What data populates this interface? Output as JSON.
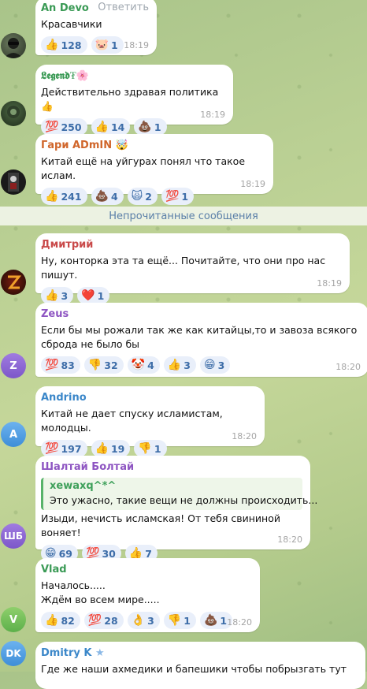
{
  "colors": {
    "link": "#3d6da8",
    "reaction_bg": "#e9effa",
    "timestamp": "#a5a5a5",
    "unread_text": "#5a7fa8"
  },
  "unread_divider": "Непрочитанные сообщения",
  "messages": [
    {
      "author": "An Devo",
      "author_color": "#3a9a55",
      "reply_label": "Ответить",
      "text": "Красавчики",
      "time": "18:19",
      "reactions": [
        {
          "emoji": "👍",
          "count": "128"
        },
        {
          "emoji": "🐷",
          "count": "1"
        }
      ]
    },
    {
      "author": "𝕷𝖊𝖌𝖊𝖓𝖉",
      "author_badge": "₮🌸",
      "author_color": "#3a9a55",
      "text": "Действительно здравая политика 👍",
      "time": "18:19",
      "reactions": [
        {
          "emoji": "💯",
          "count": "250"
        },
        {
          "emoji": "👍",
          "count": "14"
        },
        {
          "emoji": "💩",
          "count": "1"
        }
      ]
    },
    {
      "author": "Гари ADmIN",
      "author_badge": "🤯",
      "author_color": "#d0662b",
      "text": "Китай ещё на уйгурах понял что такое ислам.",
      "time": "18:19",
      "reactions": [
        {
          "emoji": "👍",
          "count": "241"
        },
        {
          "emoji": "💩",
          "count": "4"
        },
        {
          "emoji": "🙀",
          "count": "2"
        },
        {
          "emoji": "💯",
          "count": "1"
        }
      ]
    },
    {
      "author": "Дмитрий",
      "author_color": "#c94a4a",
      "text": "Ну, конторка эта та ещё... Почитайте, что они про нас пишут.",
      "time": "18:19",
      "reactions": [
        {
          "emoji": "👍",
          "count": "3"
        },
        {
          "emoji": "❤️",
          "count": "1"
        }
      ]
    },
    {
      "author": "Zeus",
      "author_color": "#8e55c2",
      "avatar_letter": "Z",
      "text": "Если бы мы рожали так же как китайцы,то и завоза всякого\nсброда не было бы",
      "time": "18:20",
      "reactions": [
        {
          "emoji": "💯",
          "count": "83"
        },
        {
          "emoji": "👎",
          "count": "32"
        },
        {
          "emoji": "🤡",
          "count": "4"
        },
        {
          "emoji": "👍",
          "count": "3"
        },
        {
          "emoji": "😁",
          "count": "3"
        }
      ]
    },
    {
      "author": "Andrino",
      "author_color": "#3b87c9",
      "avatar_letter": "A",
      "text": "Китай не дает спуску исламистам, молодцы.",
      "time": "18:20",
      "reactions": [
        {
          "emoji": "💯",
          "count": "197"
        },
        {
          "emoji": "👍",
          "count": "19"
        },
        {
          "emoji": "👎",
          "count": "1"
        }
      ]
    },
    {
      "author": "Шалтай Болтай",
      "author_color": "#8e55c2",
      "avatar_letter": "ШБ",
      "quote_author": "xewaxq^*^",
      "quote_text": "Это ужасно, такие вещи не должны происходить...",
      "text": "Изыди, нечисть исламская! От тебя свининой воняет!",
      "time": "18:20",
      "reactions": [
        {
          "emoji": "😁",
          "count": "69"
        },
        {
          "emoji": "💯",
          "count": "30"
        },
        {
          "emoji": "👍",
          "count": "7"
        }
      ]
    },
    {
      "author": "Vlad",
      "author_color": "#3a9a55",
      "avatar_letter": "V",
      "text": "Началось.....\nЖдём во всем мире.....",
      "time": "18:20",
      "reactions": [
        {
          "emoji": "👍",
          "count": "82"
        },
        {
          "emoji": "💯",
          "count": "28"
        },
        {
          "emoji": "👌",
          "count": "3"
        },
        {
          "emoji": "👎",
          "count": "1"
        },
        {
          "emoji": "💩",
          "count": "1"
        }
      ]
    },
    {
      "author": "Dmitry K",
      "author_color": "#3b87c9",
      "avatar_letter": "DK",
      "text": "Где же наши ахмедики и бапешики чтобы побрызгать тут"
    }
  ]
}
